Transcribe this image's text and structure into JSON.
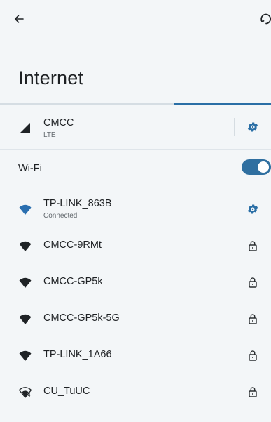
{
  "header": {
    "title": "Internet",
    "back_icon": "arrow-left-icon",
    "help_icon": "help-icon"
  },
  "mobile": {
    "name": "CMCC",
    "type": "LTE",
    "icon": "cellular-signal-icon",
    "settings_icon": "gear-icon"
  },
  "wifi": {
    "label": "Wi-Fi",
    "enabled": true
  },
  "networks": [
    {
      "name": "TP-LINK_863B",
      "status": "Connected",
      "band": "4",
      "secured": false,
      "connected": true
    },
    {
      "name": "CMCC-9RMt",
      "status": "",
      "band": "4",
      "secured": true,
      "connected": false
    },
    {
      "name": "CMCC-GP5k",
      "status": "",
      "band": "4",
      "secured": true,
      "connected": false
    },
    {
      "name": "CMCC-GP5k-5G",
      "status": "",
      "band": "5",
      "secured": true,
      "connected": false
    },
    {
      "name": "TP-LINK_1A66",
      "status": "",
      "band": "4",
      "secured": true,
      "connected": false
    },
    {
      "name": "CU_TuUC",
      "status": "",
      "band": "4",
      "secured": true,
      "connected": false
    }
  ],
  "colors": {
    "accent": "#2f6fa0",
    "background": "#f3f6f8",
    "connected_wifi": "#2a6fb0",
    "wifi_icon": "#1f2326"
  }
}
